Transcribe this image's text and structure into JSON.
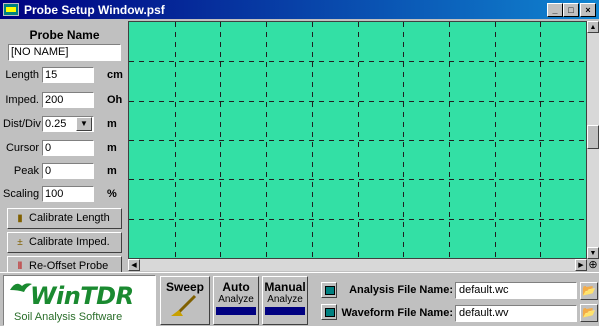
{
  "window": {
    "title": "Probe Setup Window.psf",
    "min_label": "_",
    "max_label": "□",
    "close_label": "×"
  },
  "probe": {
    "name_label": "Probe Name",
    "name_value": "[NO NAME]"
  },
  "fields": {
    "length": {
      "label": "Length",
      "value": "15",
      "unit": "cm"
    },
    "imped": {
      "label": "Imped.",
      "value": "200",
      "unit": "Oh"
    },
    "distdiv": {
      "label": "Dist/Div",
      "value": "0.25",
      "unit": "m"
    },
    "cursor": {
      "label": "Cursor",
      "value": "0",
      "unit": "m"
    },
    "peak": {
      "label": "Peak",
      "value": "0",
      "unit": "m"
    },
    "scaling": {
      "label": "Scaling",
      "value": "100",
      "unit": "%"
    }
  },
  "buttons": {
    "calibrate_length": "Calibrate Length",
    "calibrate_imped": "Calibrate Imped.",
    "reoffset_probe": "Re-Offset Probe"
  },
  "plot": {
    "background": "#33e0a5",
    "grid_cols": 10,
    "grid_rows": 6
  },
  "logo": {
    "brand": "WinTDR",
    "tagline": "Soil Analysis Software"
  },
  "tools": {
    "sweep": "Sweep",
    "auto": {
      "title": "Auto",
      "sub": "Analyze"
    },
    "manual": {
      "title": "Manual",
      "sub": "Analyze"
    }
  },
  "files": {
    "analysis_label": "Analysis File Name:",
    "analysis_value": "default.wc",
    "waveform_label": "Waveform File Name:",
    "waveform_value": "default.wv"
  }
}
